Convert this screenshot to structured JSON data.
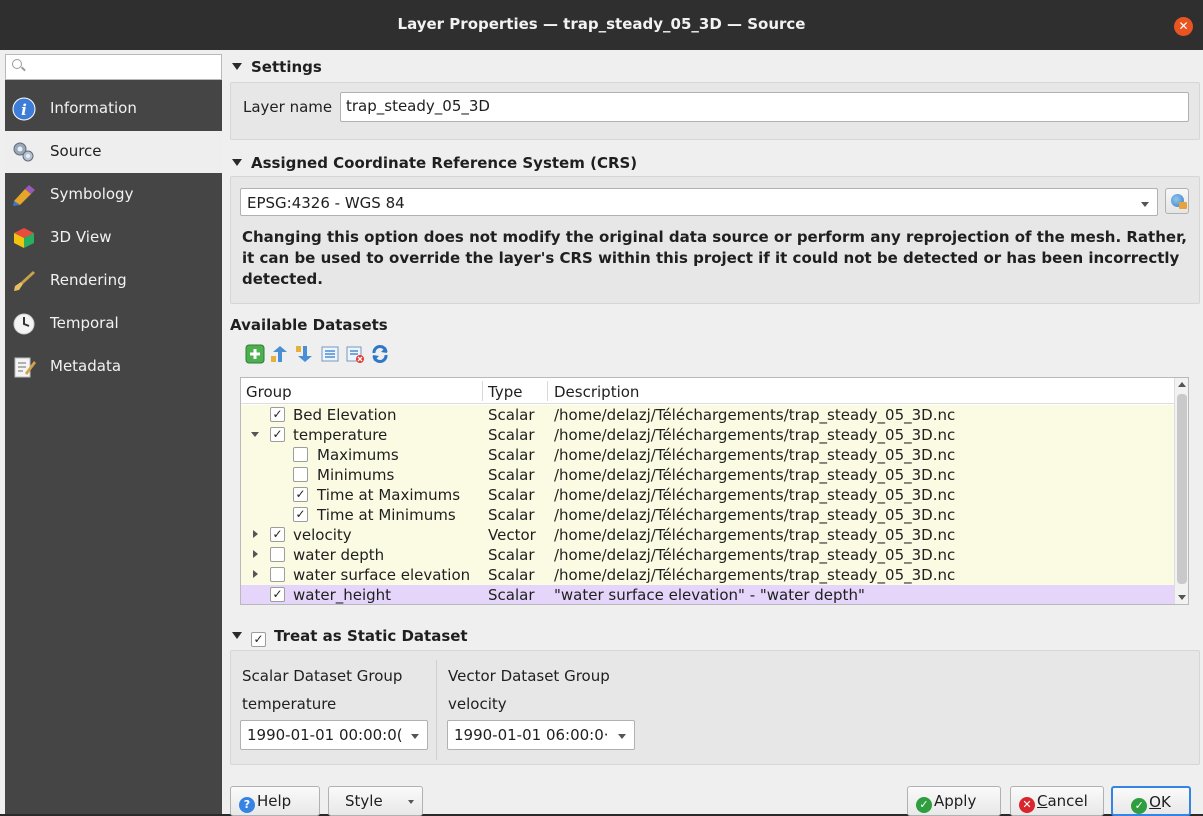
{
  "window": {
    "title": "Layer Properties — trap_steady_05_3D — Source"
  },
  "sidebar": {
    "search_placeholder": "",
    "items": [
      {
        "label": "Information",
        "icon": "info-icon"
      },
      {
        "label": "Source",
        "icon": "source-icon"
      },
      {
        "label": "Symbology",
        "icon": "symbology-icon"
      },
      {
        "label": "3D View",
        "icon": "3d-view-icon"
      },
      {
        "label": "Rendering",
        "icon": "rendering-icon"
      },
      {
        "label": "Temporal",
        "icon": "clock-icon"
      },
      {
        "label": "Metadata",
        "icon": "metadata-icon"
      }
    ],
    "active": "Source"
  },
  "settings": {
    "header": "Settings",
    "layer_name_label": "Layer name",
    "layer_name_value": "trap_steady_05_3D"
  },
  "crs": {
    "header": "Assigned Coordinate Reference System (CRS)",
    "selected": "EPSG:4326 - WGS 84",
    "warning": "Changing this option does not modify the original data source or perform any reprojection of the mesh. Rather, it can be used to override the layer's CRS within this project if it could not be detected or has been incorrectly detected."
  },
  "datasets": {
    "header": "Available Datasets",
    "toolbar": [
      "add-dataset-icon",
      "move-up-icon",
      "move-down-icon",
      "expand-all-icon",
      "remove-icon",
      "refresh-icon"
    ],
    "columns": [
      "Group",
      "Type",
      "Description"
    ],
    "rows": [
      {
        "group": "Bed Elevation",
        "type": "Scalar",
        "description": "/home/delazj/Téléchargements/trap_steady_05_3D.nc",
        "checked": true,
        "expander": "none",
        "indent": 0
      },
      {
        "group": "temperature",
        "type": "Scalar",
        "description": "/home/delazj/Téléchargements/trap_steady_05_3D.nc",
        "checked": true,
        "expander": "down",
        "indent": 0
      },
      {
        "group": "Maximums",
        "type": "Scalar",
        "description": "/home/delazj/Téléchargements/trap_steady_05_3D.nc",
        "checked": false,
        "expander": "none",
        "indent": 1
      },
      {
        "group": "Minimums",
        "type": "Scalar",
        "description": "/home/delazj/Téléchargements/trap_steady_05_3D.nc",
        "checked": false,
        "expander": "none",
        "indent": 1
      },
      {
        "group": "Time at Maximums",
        "type": "Scalar",
        "description": "/home/delazj/Téléchargements/trap_steady_05_3D.nc",
        "checked": true,
        "expander": "none",
        "indent": 1
      },
      {
        "group": "Time at Minimums",
        "type": "Scalar",
        "description": "/home/delazj/Téléchargements/trap_steady_05_3D.nc",
        "checked": true,
        "expander": "none",
        "indent": 1
      },
      {
        "group": "velocity",
        "type": "Vector",
        "description": "/home/delazj/Téléchargements/trap_steady_05_3D.nc",
        "checked": true,
        "expander": "right",
        "indent": 0
      },
      {
        "group": "water depth",
        "type": "Scalar",
        "description": "/home/delazj/Téléchargements/trap_steady_05_3D.nc",
        "checked": false,
        "expander": "right",
        "indent": 0
      },
      {
        "group": "water surface elevation",
        "type": "Scalar",
        "description": "/home/delazj/Téléchargements/trap_steady_05_3D.nc",
        "checked": false,
        "expander": "right",
        "indent": 0
      },
      {
        "group": "water_height",
        "type": "Scalar",
        "description": "\"water surface elevation\"  -  \"water depth\"",
        "checked": true,
        "expander": "none",
        "indent": 0,
        "highlight": true
      }
    ]
  },
  "static_dataset": {
    "header": "Treat as Static Dataset",
    "checked": true,
    "scalar_label": "Scalar Dataset Group",
    "scalar_group": "temperature",
    "scalar_time": "1990-01-01 00:00:0(",
    "vector_label": "Vector Dataset Group",
    "vector_group": "velocity",
    "vector_time": "1990-01-01 06:00:0·"
  },
  "buttons": {
    "help": "Help",
    "style": "Style",
    "apply": "Apply",
    "cancel_prefix": "C",
    "cancel_rest": "ancel",
    "ok_prefix": "O",
    "ok_rest": "K"
  },
  "colors": {
    "accent": "#3584e4",
    "close": "#e95420",
    "sidebar_bg": "#454545",
    "row_bg": "#fbfbe3",
    "row_highlight": "#e6d5fb"
  }
}
